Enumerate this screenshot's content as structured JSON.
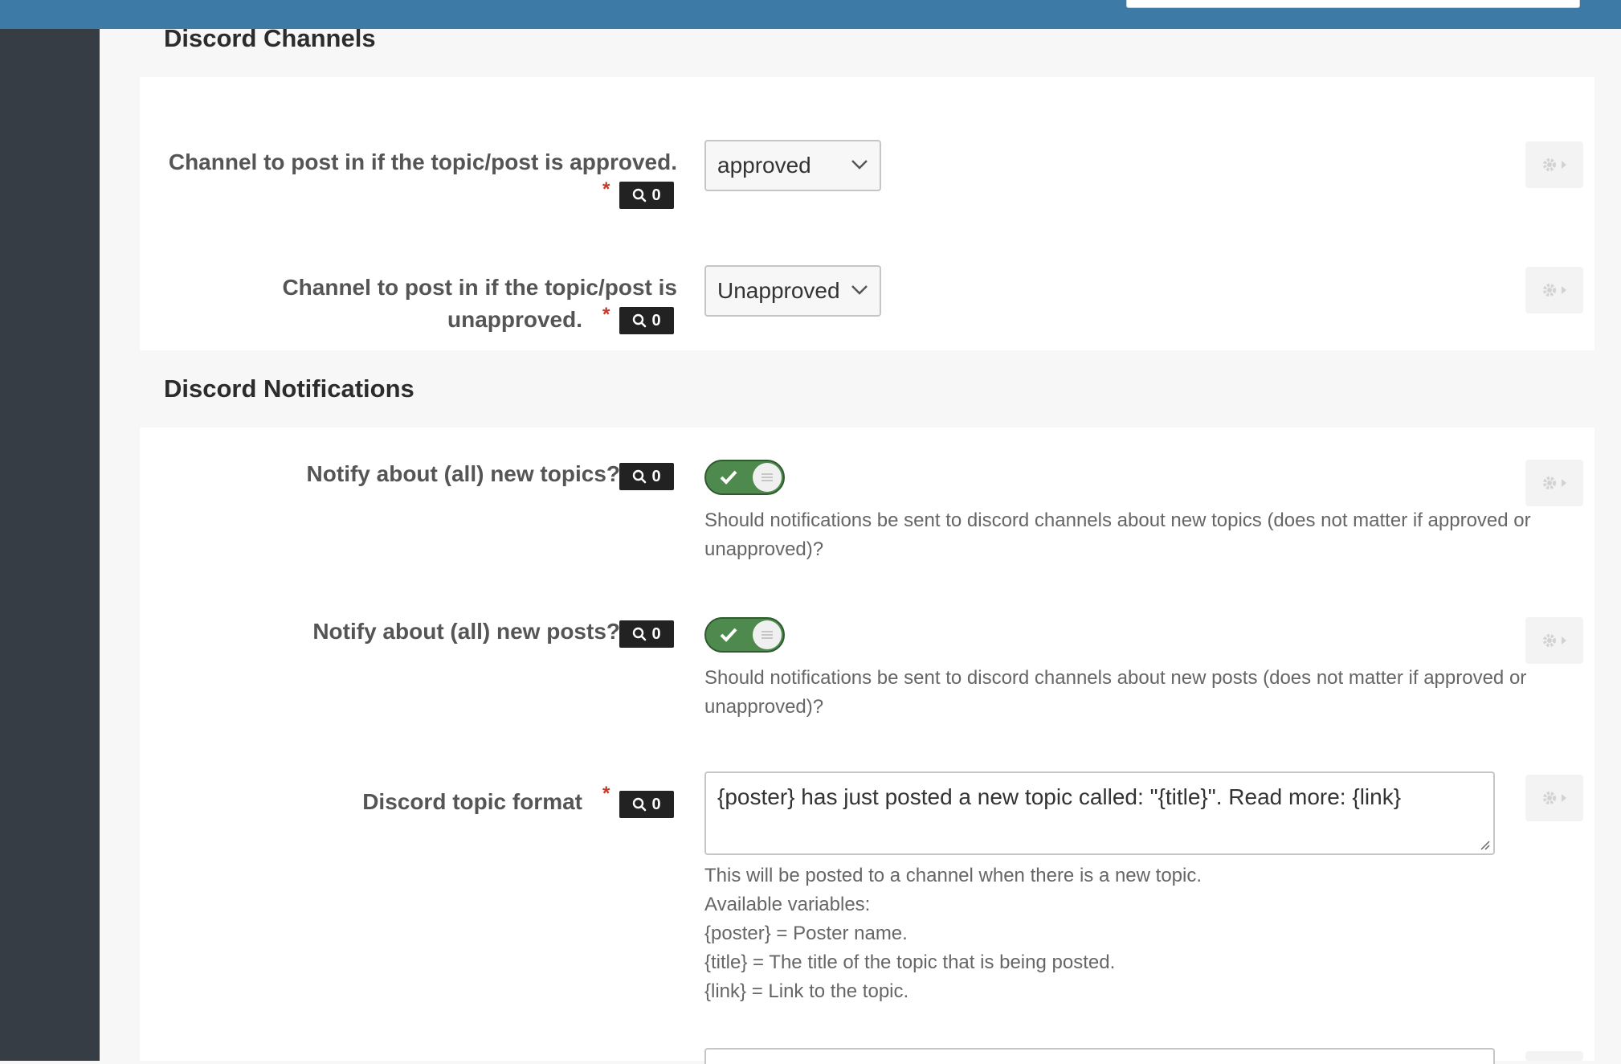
{
  "channels": {
    "title": "Discord Channels",
    "approved": {
      "label": "Channel to post in if the topic/post is approved.",
      "required": "*",
      "badge": "0",
      "value": "approved"
    },
    "unapproved": {
      "label_line1": "Channel to post in if the topic/post is",
      "label_line2": "unapproved.",
      "required": "*",
      "badge": "0",
      "value": "Unapproved"
    }
  },
  "notifications": {
    "title": "Discord Notifications",
    "topics": {
      "label": "Notify about (all) new topics?",
      "badge": "0",
      "enabled": true,
      "help_line1": "Should notifications be sent to discord channels about new topics (does not matter if approved or",
      "help_line2": "unapproved)?"
    },
    "posts": {
      "label": "Notify about (all) new posts?",
      "badge": "0",
      "enabled": true,
      "help_line1": "Should notifications be sent to discord channels about new posts (does not matter if approved or",
      "help_line2": "unapproved)?"
    },
    "topic_format": {
      "label": "Discord topic format",
      "required": "*",
      "badge": "0",
      "value": "{poster} has just posted a new topic called: \"{title}\". Read more: {link}",
      "help": [
        "This will be posted to a channel when there is a new topic.",
        "Available variables:",
        "{poster} = Poster name.",
        "{title} = The title of the topic that is being posted.",
        "{link} = Link to the topic."
      ]
    }
  },
  "icons": {
    "search": "search-icon",
    "gear": "gear-icon",
    "chevron": "chevron-down-icon",
    "check": "check-icon"
  },
  "colors": {
    "topbar": "#3d7ba6",
    "leftnav": "#363d45",
    "toggle_on": "#4e8a4e",
    "required": "#c0392b"
  }
}
